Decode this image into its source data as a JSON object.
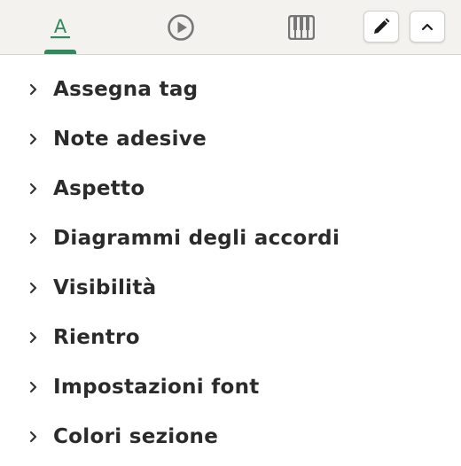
{
  "toolbar": {
    "tabs": [
      {
        "icon": "text-format-icon",
        "active": true
      },
      {
        "icon": "play-circle-icon",
        "active": false
      },
      {
        "icon": "piano-keys-icon",
        "active": false
      }
    ],
    "buttons": [
      {
        "icon": "pencil-icon"
      },
      {
        "icon": "chevron-up-icon"
      }
    ],
    "accent_color": "#2f8a5f",
    "icon_color": "#777777"
  },
  "menu": {
    "items": [
      {
        "label": "Assegna tag"
      },
      {
        "label": "Note adesive"
      },
      {
        "label": "Aspetto"
      },
      {
        "label": "Diagrammi degli accordi"
      },
      {
        "label": "Visibilità"
      },
      {
        "label": "Rientro"
      },
      {
        "label": "Impostazioni font"
      },
      {
        "label": "Colori sezione"
      }
    ]
  }
}
